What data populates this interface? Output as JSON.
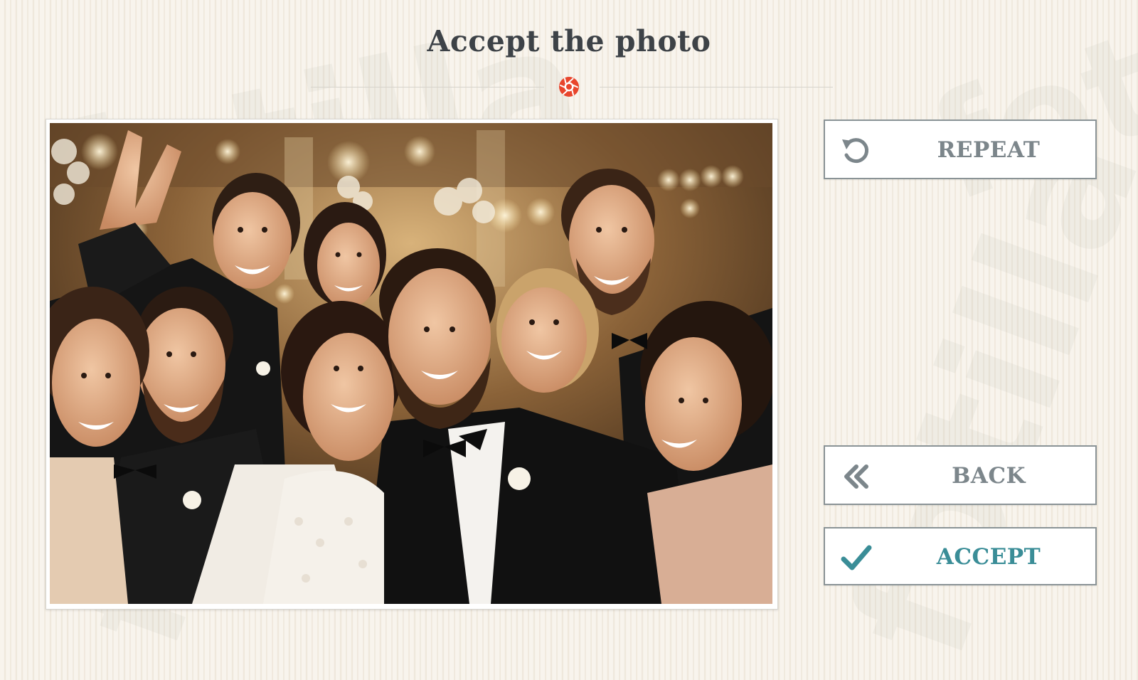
{
  "page": {
    "title": "Accept the photo",
    "brand_watermark": "fotilla"
  },
  "colors": {
    "title_text": "#3d4247",
    "button_text": "#7c868b",
    "accept_accent": "#3a8d97",
    "shutter_icon": "#e8452c",
    "button_border": "#8a9396"
  },
  "icons": {
    "header": "camera-shutter-icon",
    "repeat": "rotate-ccw-icon",
    "back": "double-chevron-left-icon",
    "accept": "checkmark-icon"
  },
  "photo": {
    "subject": "wedding-group-selfie"
  },
  "buttons": {
    "repeat_label": "REPEAT",
    "back_label": "BACK",
    "accept_label": "ACCEPT"
  }
}
